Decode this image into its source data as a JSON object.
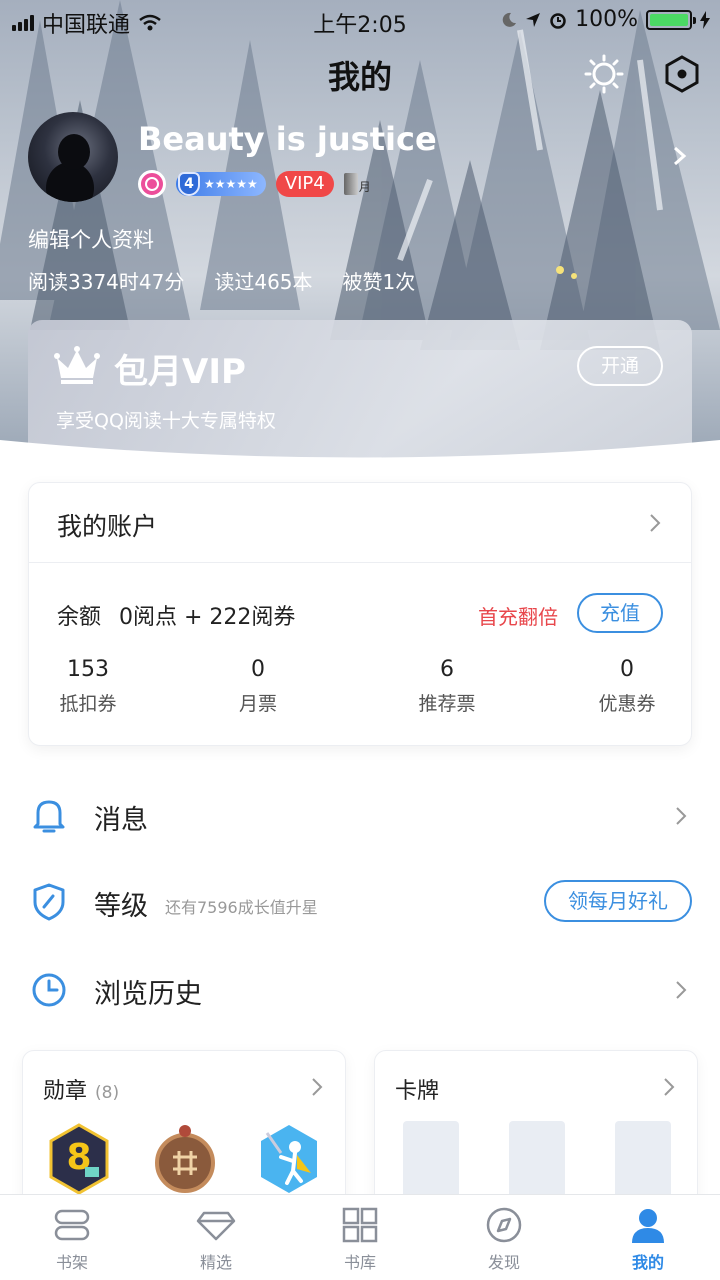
{
  "status_bar": {
    "carrier": "中国联通",
    "time": "上午2:05",
    "battery": "100%"
  },
  "header": {
    "title": "我的"
  },
  "profile": {
    "username": "Beauty is justice",
    "level_badge": "4",
    "vip_badge": "VIP4",
    "month_badge": "月",
    "edit_label": "编辑个人资料",
    "stats": {
      "reading_time": "阅读3374时47分",
      "books_read": "读过465本",
      "likes": "被赞1次"
    }
  },
  "vip_card": {
    "title": "包月VIP",
    "subtitle": "享受QQ阅读十大专属特权",
    "button": "开通"
  },
  "account": {
    "title": "我的账户",
    "balance_label": "余额",
    "balance_value": "0阅点 + 222阅券",
    "promo": "首充翻倍",
    "recharge": "充值",
    "stats": [
      {
        "value": "153",
        "label": "抵扣券"
      },
      {
        "value": "0",
        "label": "月票"
      },
      {
        "value": "6",
        "label": "推荐票"
      },
      {
        "value": "0",
        "label": "优惠券"
      }
    ]
  },
  "menu": {
    "messages": "消息",
    "level": "等级",
    "level_hint": "还有7596成长值升星",
    "level_button": "领每月好礼",
    "history": "浏览历史"
  },
  "cards": {
    "medals": {
      "title": "勋章",
      "count": "(8)",
      "icons": [
        "medal-8-icon",
        "medal-bronze-icon",
        "medal-hero-icon"
      ]
    },
    "cardboard": {
      "title": "卡牌"
    }
  },
  "tabbar": [
    {
      "label": "书架",
      "icon": "bookshelf-icon"
    },
    {
      "label": "精选",
      "icon": "diamond-icon"
    },
    {
      "label": "书库",
      "icon": "grid-icon"
    },
    {
      "label": "发现",
      "icon": "compass-icon"
    },
    {
      "label": "我的",
      "icon": "user-icon"
    }
  ],
  "colors": {
    "accent": "#2f8ae6",
    "promo": "#e8474c",
    "vip_badge": "#f04848"
  }
}
